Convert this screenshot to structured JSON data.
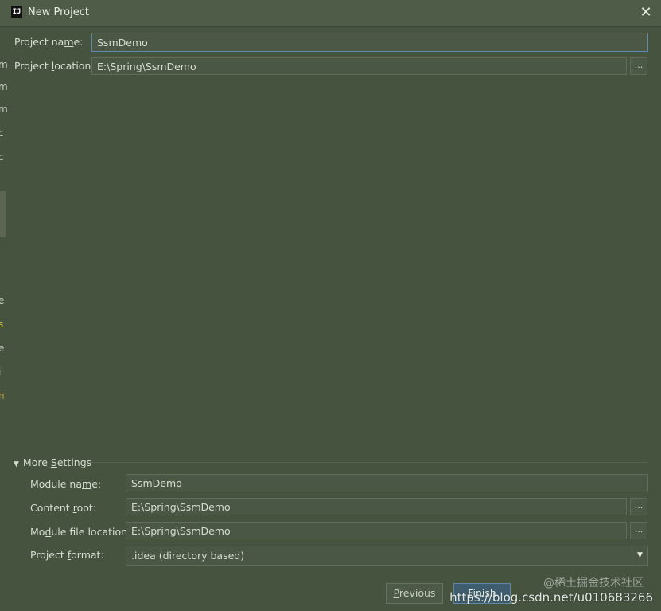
{
  "window": {
    "title": "New Project",
    "app_icon": "IJ"
  },
  "project": {
    "name_label_pre": "Project na",
    "name_label_mn": "m",
    "name_label_post": "e:",
    "name_value": "SsmDemo",
    "location_label_pre": "Project ",
    "location_label_mn": "l",
    "location_label_post": "ocation:",
    "location_value": "E:\\Spring\\SsmDemo",
    "browse_label": "..."
  },
  "more_settings": {
    "toggle_label_pre": "More ",
    "toggle_label_mn": "S",
    "toggle_label_post": "ettings",
    "module_name_label_pre": "Module na",
    "module_name_label_mn": "m",
    "module_name_label_post": "e:",
    "module_name_value": "SsmDemo",
    "content_root_label_pre": "Content ",
    "content_root_label_mn": "r",
    "content_root_label_post": "oot:",
    "content_root_value": "E:\\Spring\\SsmDemo",
    "module_file_label_pre": "Mo",
    "module_file_label_mn": "d",
    "module_file_label_post": "ule file location:",
    "module_file_value": "E:\\Spring\\SsmDemo",
    "project_format_label_pre": "Project ",
    "project_format_label_mn": "f",
    "project_format_label_post": "ormat:",
    "project_format_value": ".idea (directory based)",
    "browse_label": "..."
  },
  "buttons": {
    "previous_mn": "P",
    "previous_rest": "revious",
    "finish_mn": "F",
    "finish_rest": "inish"
  },
  "background_chars": [
    "m",
    "m",
    "m",
    "c",
    "c",
    "e",
    "s",
    "e",
    "i",
    "n"
  ],
  "watermarks": {
    "brand": "@稀土掘金技术社区",
    "url": "https://blog.csdn.net/u010683266"
  }
}
